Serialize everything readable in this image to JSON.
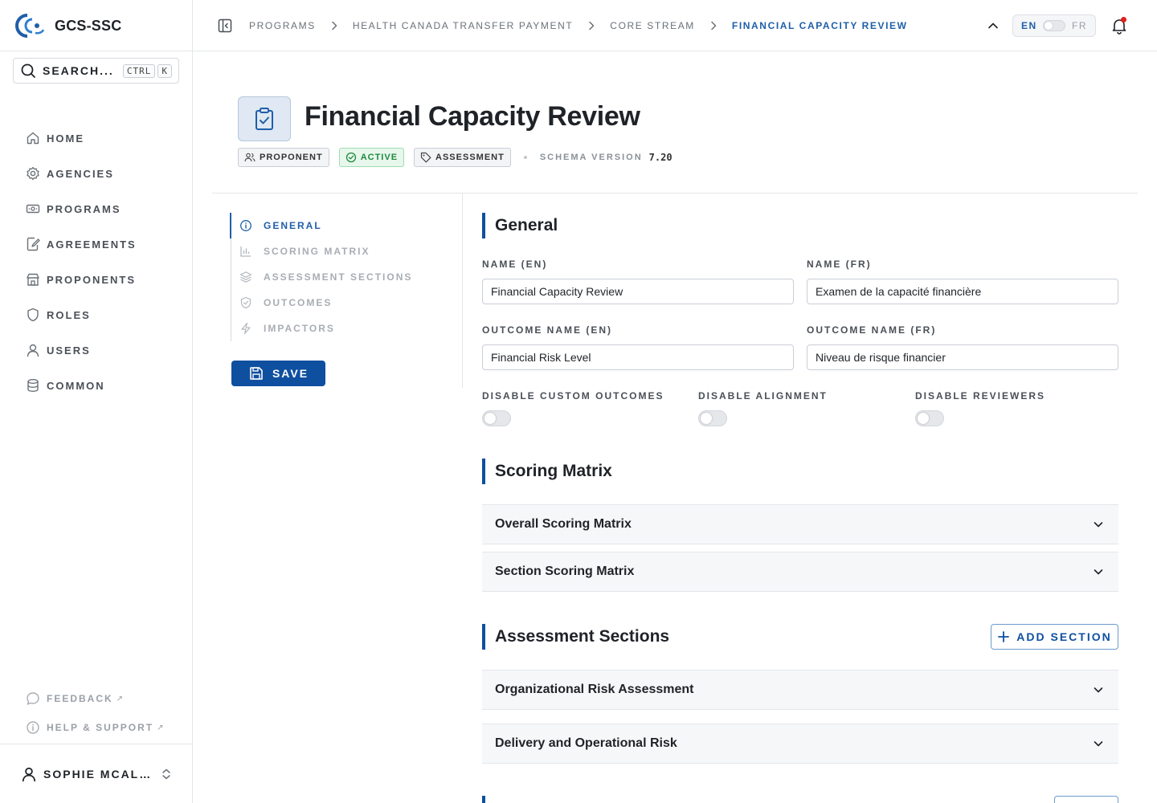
{
  "brand": {
    "name": "GCS-SSC",
    "logo_icon": "gcs-logo"
  },
  "search": {
    "label": "SEARCH...",
    "shortcut": [
      "CTRL",
      "K"
    ]
  },
  "sidebar": {
    "items": [
      {
        "label": "HOME",
        "icon": "home-icon"
      },
      {
        "label": "AGENCIES",
        "icon": "gear-icon"
      },
      {
        "label": "PROGRAMS",
        "icon": "money-icon"
      },
      {
        "label": "AGREEMENTS",
        "icon": "document-edit-icon"
      },
      {
        "label": "PROPONENTS",
        "icon": "building-icon"
      },
      {
        "label": "ROLES",
        "icon": "shield-icon"
      },
      {
        "label": "USERS",
        "icon": "user-icon"
      },
      {
        "label": "COMMON",
        "icon": "database-icon"
      }
    ],
    "footer_links": [
      {
        "label": "FEEDBACK",
        "icon": "chat-icon"
      },
      {
        "label": "HELP & SUPPORT",
        "icon": "info-icon"
      }
    ],
    "user": {
      "name": "SOPHIE MCALLISTER"
    }
  },
  "breadcrumb": [
    "PROGRAMS",
    "HEALTH CANADA TRANSFER PAYMENT",
    "CORE STREAM",
    "FINANCIAL CAPACITY REVIEW"
  ],
  "language": {
    "en": "EN",
    "fr": "FR",
    "active": "EN"
  },
  "header": {
    "title": "Financial Capacity Review",
    "badges": [
      {
        "label": "PROPONENT",
        "icon": "users-icon"
      },
      {
        "label": "ACTIVE",
        "icon": "check-circle-icon"
      },
      {
        "label": "ASSESSMENT",
        "icon": "tag-icon"
      }
    ],
    "schema_label": "SCHEMA VERSION",
    "schema_version": "7.20"
  },
  "section_nav": [
    {
      "label": "GENERAL",
      "icon": "info-icon",
      "active": true
    },
    {
      "label": "SCORING MATRIX",
      "icon": "bar-chart-icon",
      "active": false
    },
    {
      "label": "ASSESSMENT SECTIONS",
      "icon": "layers-icon",
      "active": false
    },
    {
      "label": "OUTCOMES",
      "icon": "shield-check-icon",
      "active": false
    },
    {
      "label": "IMPACTORS",
      "icon": "lightning-icon",
      "active": false
    }
  ],
  "save_label": "SAVE",
  "general": {
    "heading": "General",
    "name_en_label": "NAME (EN)",
    "name_en": "Financial Capacity Review",
    "name_fr_label": "NAME (FR)",
    "name_fr": "Examen de la capacité financière",
    "outcome_en_label": "OUTCOME NAME (EN)",
    "outcome_en": "Financial Risk Level",
    "outcome_fr_label": "OUTCOME NAME (FR)",
    "outcome_fr": "Niveau de risque financier",
    "toggles": [
      {
        "label": "DISABLE CUSTOM OUTCOMES",
        "on": false
      },
      {
        "label": "DISABLE ALIGNMENT",
        "on": false
      },
      {
        "label": "DISABLE REVIEWERS",
        "on": false
      }
    ]
  },
  "scoring": {
    "heading": "Scoring Matrix",
    "items": [
      "Overall Scoring Matrix",
      "Section Scoring Matrix"
    ]
  },
  "assessment_sections": {
    "heading": "Assessment Sections",
    "add_label": "ADD SECTION",
    "items": [
      "Organizational Risk Assessment",
      "Delivery and Operational Risk"
    ]
  },
  "colors": {
    "accent": "#0f4fa0",
    "active_green": "#1d8a3f",
    "notification": "#e0201c"
  }
}
